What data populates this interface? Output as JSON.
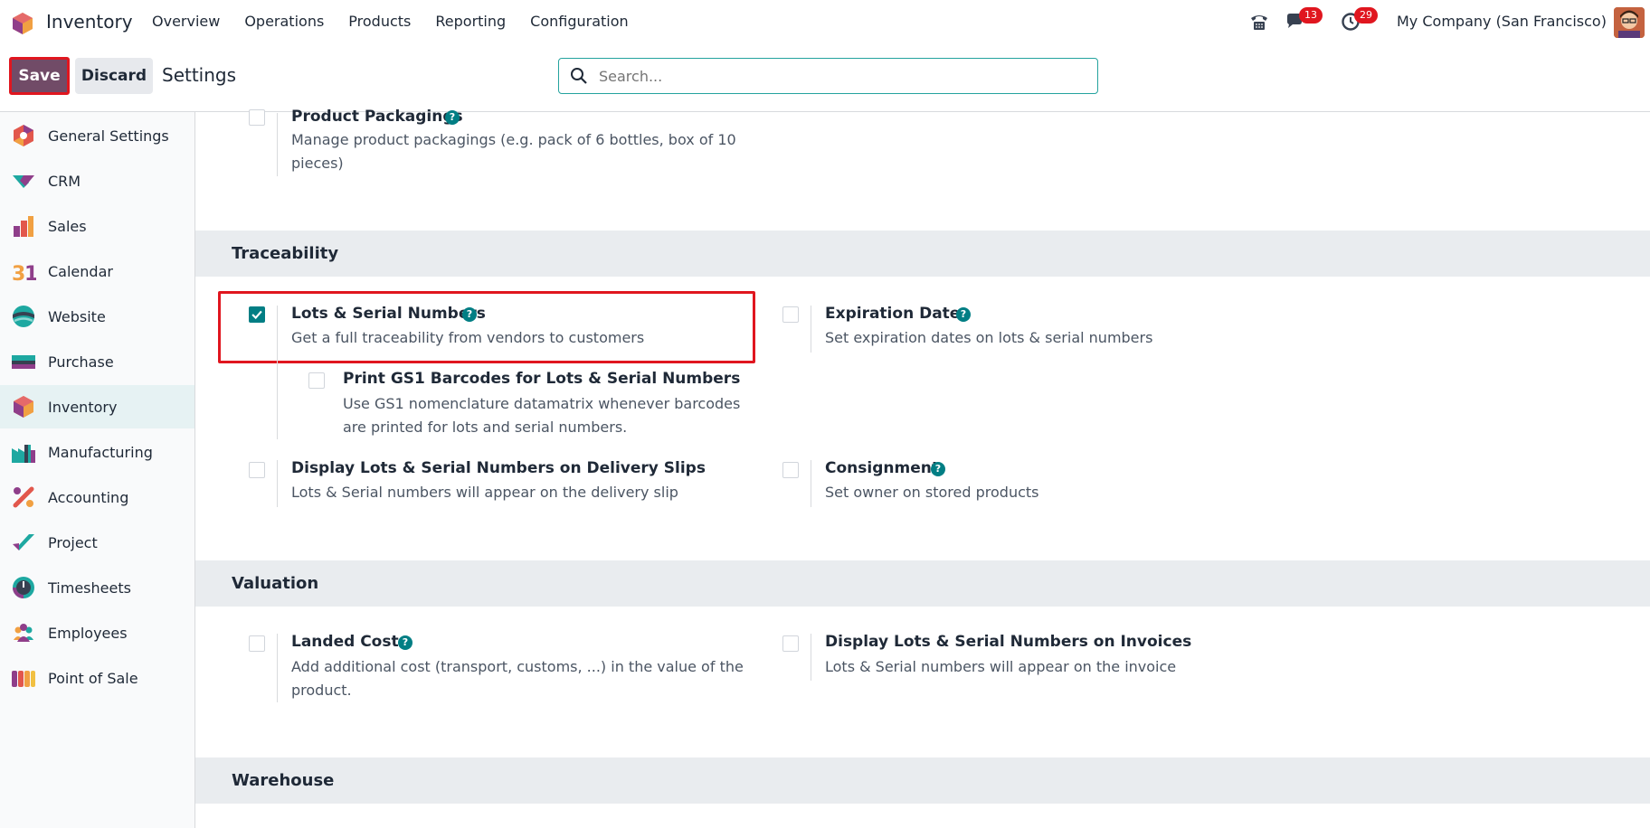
{
  "app": {
    "name": "Inventory"
  },
  "menu": [
    "Overview",
    "Operations",
    "Products",
    "Reporting",
    "Configuration"
  ],
  "systray": {
    "messages_count": "13",
    "activities_count": "29",
    "company": "My Company (San Francisco)"
  },
  "control": {
    "save_label": "Save",
    "discard_label": "Discard",
    "title": "Settings",
    "search_placeholder": "Search..."
  },
  "sidebar": {
    "items": [
      {
        "label": "General Settings",
        "icon": "general-settings-icon"
      },
      {
        "label": "CRM",
        "icon": "crm-icon"
      },
      {
        "label": "Sales",
        "icon": "sales-icon"
      },
      {
        "label": "Calendar",
        "icon": "calendar-icon"
      },
      {
        "label": "Website",
        "icon": "website-icon"
      },
      {
        "label": "Purchase",
        "icon": "purchase-icon"
      },
      {
        "label": "Inventory",
        "icon": "inventory-icon",
        "active": true
      },
      {
        "label": "Manufacturing",
        "icon": "manufacturing-icon"
      },
      {
        "label": "Accounting",
        "icon": "accounting-icon"
      },
      {
        "label": "Project",
        "icon": "project-icon"
      },
      {
        "label": "Timesheets",
        "icon": "timesheets-icon"
      },
      {
        "label": "Employees",
        "icon": "employees-icon"
      },
      {
        "label": "Point of Sale",
        "icon": "point-of-sale-icon"
      }
    ]
  },
  "settings": {
    "product_packagings": {
      "title": "Product Packagings",
      "desc_1": "Manage product packagings (e.g. pack of 6 bottles, box of 10",
      "desc_2": "pieces)",
      "checked": false
    },
    "traceability": {
      "heading": "Traceability",
      "lots": {
        "title": "Lots & Serial Numbers",
        "desc": "Get a full traceability from vendors to customers",
        "checked": true
      },
      "gs1": {
        "title": "Print GS1 Barcodes for Lots & Serial Numbers",
        "desc_1": "Use GS1 nomenclature datamatrix whenever barcodes",
        "desc_2": "are printed for lots and serial numbers.",
        "checked": false
      },
      "expiration": {
        "title": "Expiration Dates",
        "desc": "Set expiration dates on lots & serial numbers",
        "checked": false
      },
      "delivery_slips": {
        "title": "Display Lots & Serial Numbers on Delivery Slips",
        "desc": "Lots & Serial numbers will appear on the delivery slip",
        "checked": false
      },
      "consignment": {
        "title": "Consignment",
        "desc": "Set owner on stored products",
        "checked": false
      }
    },
    "valuation": {
      "heading": "Valuation",
      "landed_costs": {
        "title": "Landed Costs",
        "desc_1": "Add additional cost (transport, customs, ...) in the value of the",
        "desc_2": "product.",
        "checked": false
      },
      "invoices": {
        "title": "Display Lots & Serial Numbers on Invoices",
        "desc": "Lots & Serial numbers will appear on the invoice",
        "checked": false
      }
    },
    "warehouse": {
      "heading": "Warehouse"
    }
  },
  "colors": {
    "brand": "#714b67",
    "teal": "#017e84",
    "highlight": "#e0161f"
  }
}
